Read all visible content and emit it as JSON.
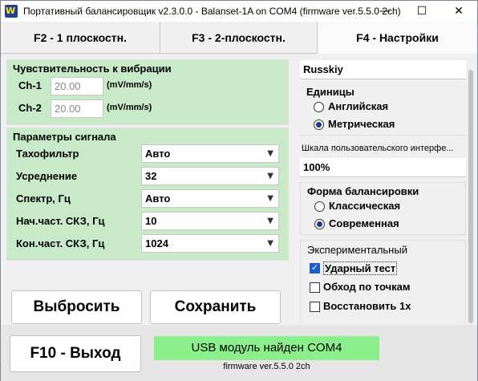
{
  "window": {
    "icon_text": "W",
    "title": "Портативный балансировщик v2.3.0.0 - Balanset-1A on COM4 (firmware ver.5.5.0 2ch)",
    "minimize_glyph": "—",
    "maximize_glyph": "☐",
    "close_glyph": "✕"
  },
  "tabs": [
    {
      "label": "F2 - 1 плоскостн."
    },
    {
      "label": "F3 - 2-плоскостн."
    },
    {
      "label": "F4 - Настройки"
    }
  ],
  "sensitivity": {
    "title": "Чувствительность к вибрации",
    "channels": [
      {
        "label": "Ch-1",
        "value": "20.00",
        "unit": "(mV/mm/s)"
      },
      {
        "label": "Ch-2",
        "value": "20.00",
        "unit": "(mV/mm/s)"
      }
    ]
  },
  "signal": {
    "title": "Параметры сигнала",
    "rows": [
      {
        "label": "Тахофильтр",
        "value": "Авто"
      },
      {
        "label": "Усреднение",
        "value": "32"
      },
      {
        "label": "Спектр, Гц",
        "value": "Авто"
      },
      {
        "label": "Нач.част. СКЗ, Гц",
        "value": "10"
      },
      {
        "label": "Кон.част. СКЗ, Гц",
        "value": "1024"
      }
    ]
  },
  "actions": {
    "reset_label": "Выбросить",
    "save_label": "Сохранить"
  },
  "settings": {
    "language": "Russkiy",
    "units": {
      "title": "Единицы",
      "options": [
        {
          "label": "Английская",
          "selected": false
        },
        {
          "label": "Метрическая",
          "selected": true
        }
      ]
    },
    "ui_scale": {
      "title": "Шкала пользовательского интерфе...",
      "value": "100%"
    },
    "balancing_form": {
      "title": "Форма балансировки",
      "options": [
        {
          "label": "Классическая",
          "selected": false
        },
        {
          "label": "Современная",
          "selected": true
        }
      ]
    },
    "experimental": {
      "title": "Экспериментальный",
      "options": [
        {
          "label": "Ударный тест",
          "checked": true
        },
        {
          "label": "Обход по точкам",
          "checked": false
        },
        {
          "label": "Восстановить 1x",
          "checked": false
        }
      ]
    }
  },
  "footer": {
    "exit_label": "F10 - Выход",
    "status": "USB модуль найден COM4",
    "firmware": "firmware ver.5.5.0 2ch"
  },
  "colors": {
    "panel_green": "#c8eac8",
    "status_green": "#8bf08b",
    "check_blue": "#1a5dc8"
  }
}
